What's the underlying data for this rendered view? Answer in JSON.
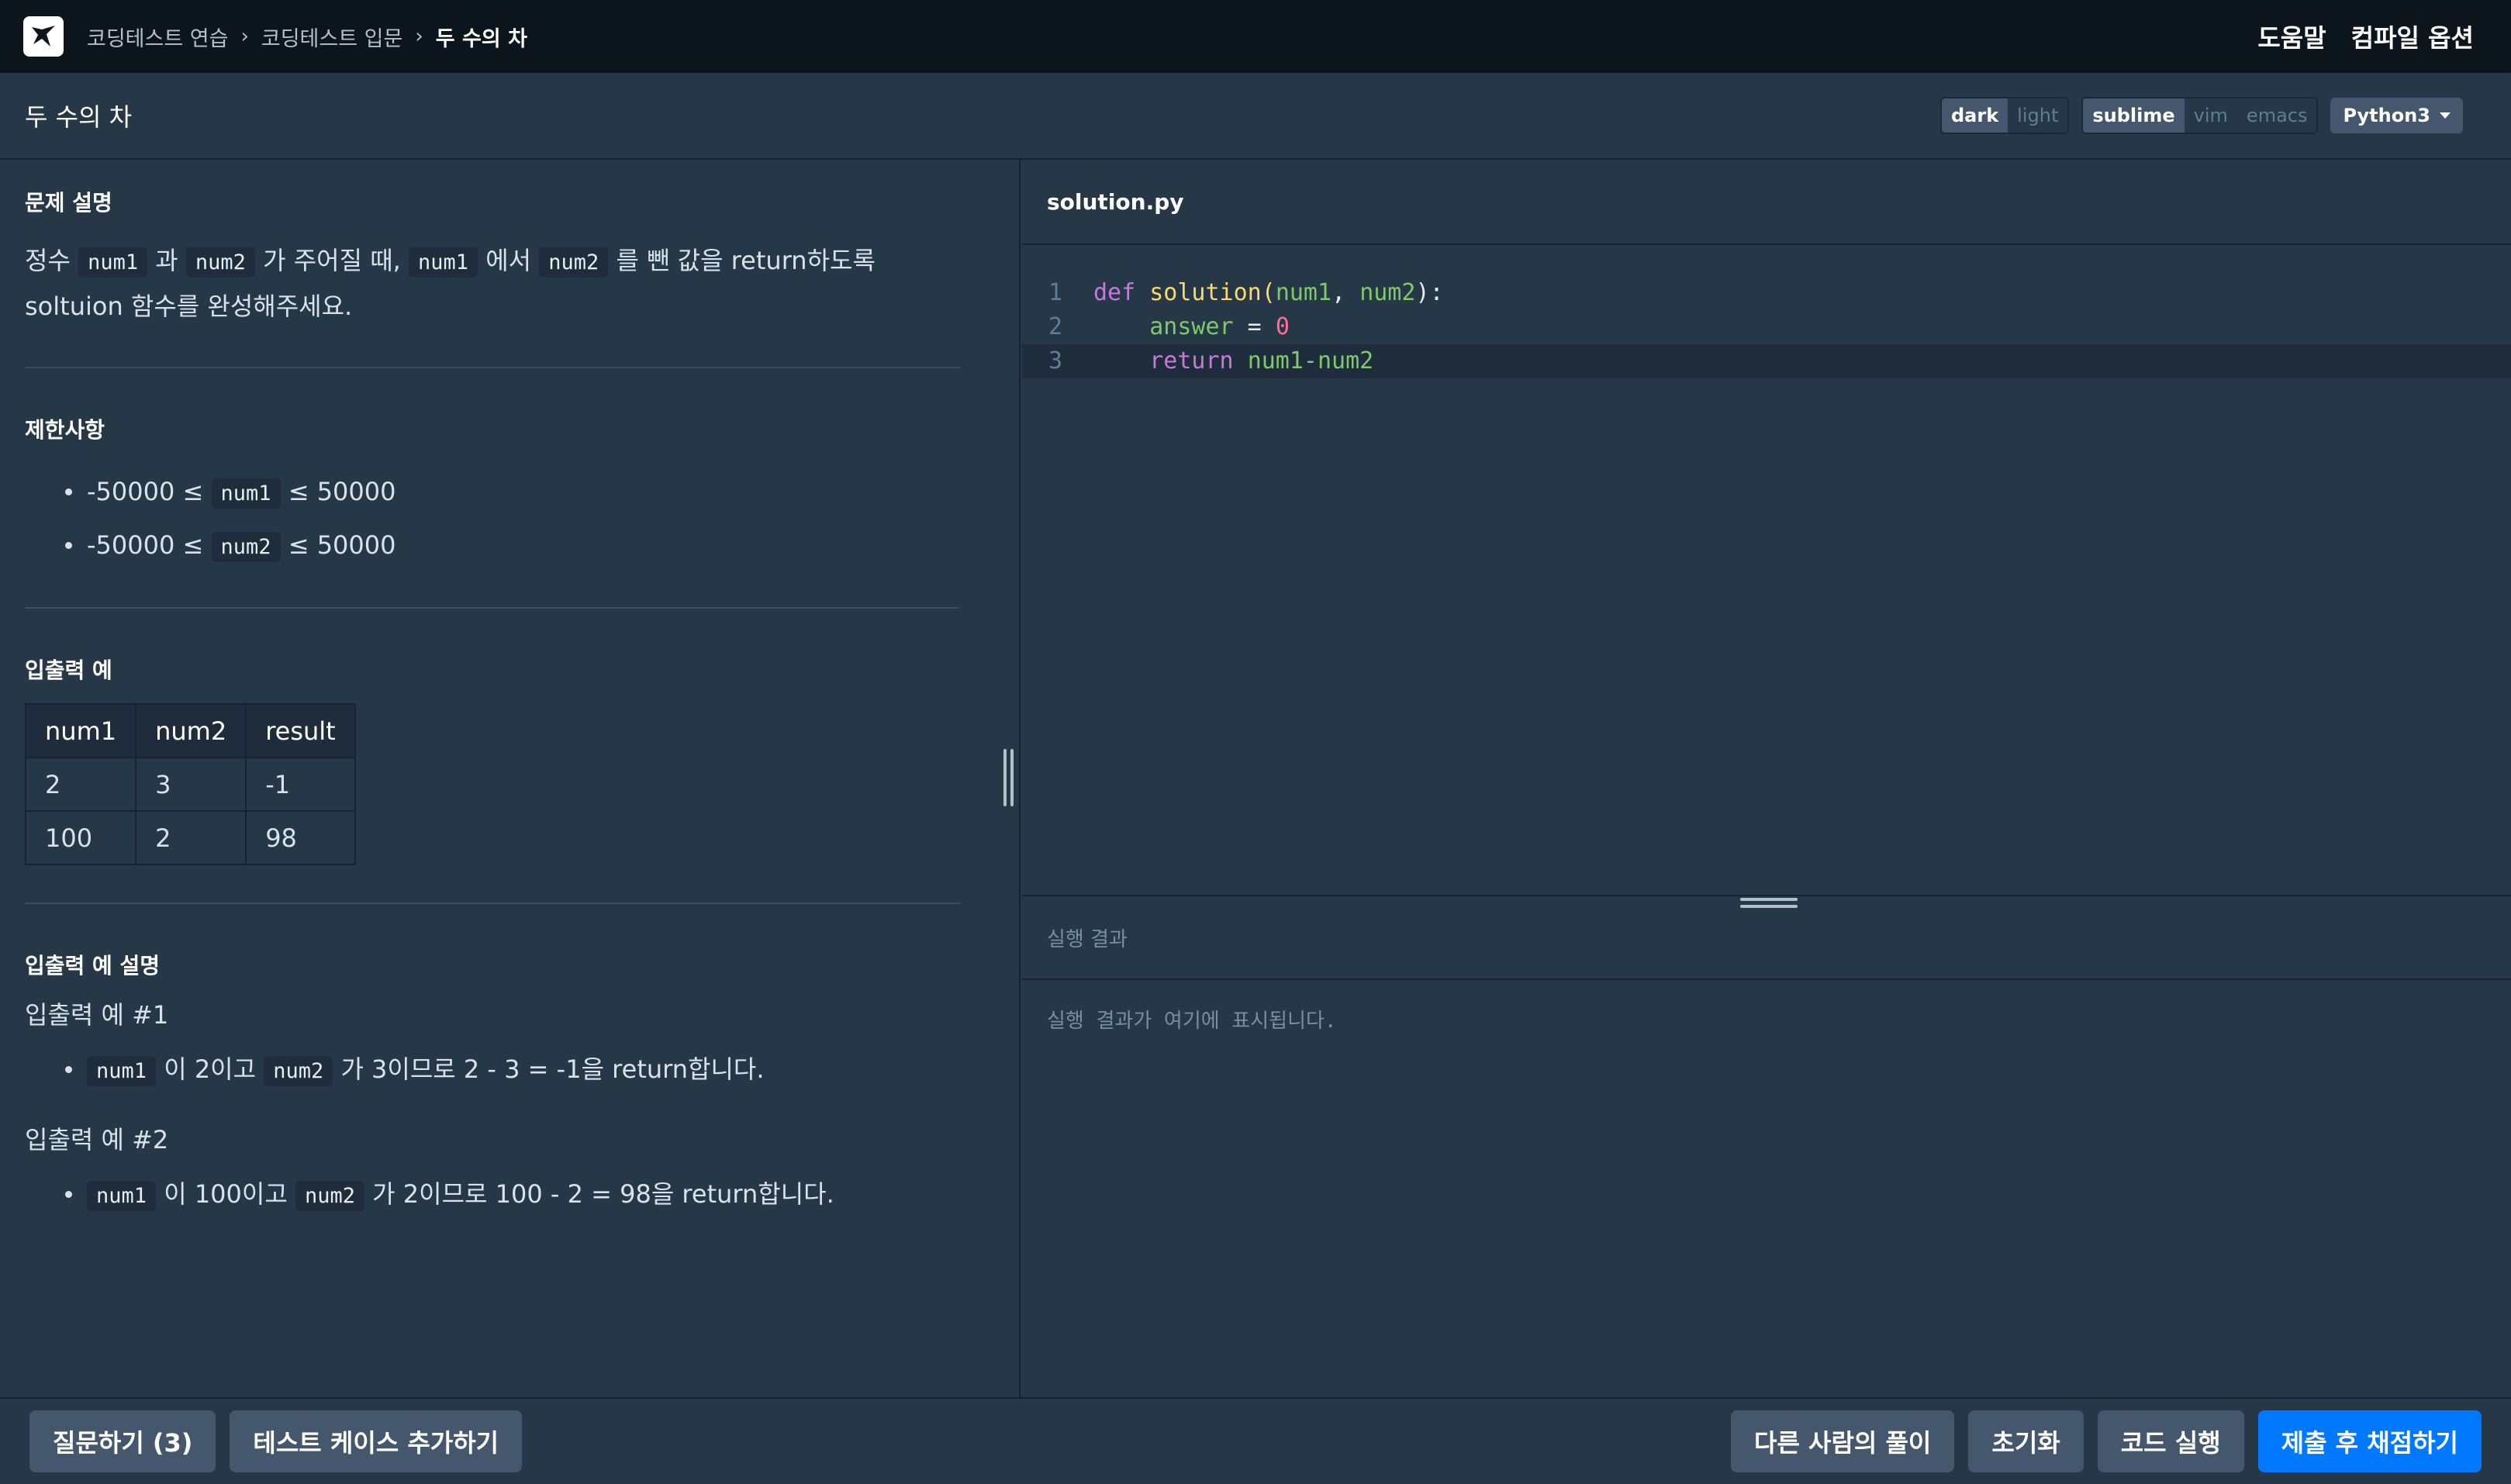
{
  "header": {
    "breadcrumbs": [
      "코딩테스트 연습",
      "코딩테스트 입문",
      "두 수의 차"
    ],
    "nav": [
      "도움말",
      "컴파일 옵션"
    ]
  },
  "title": "두 수의 차",
  "settings": {
    "theme": [
      "dark",
      "light"
    ],
    "keymap": [
      "sublime",
      "vim",
      "emacs"
    ],
    "language": "Python3"
  },
  "problem": {
    "desc_title": "문제 설명",
    "desc": {
      "t1": "정수 ",
      "c1": "num1",
      "t2": " 과 ",
      "c2": "num2",
      "t3": " 가 주어질 때, ",
      "c3": "num1",
      "t4": " 에서 ",
      "c4": "num2",
      "t5": " 를 뺀 값을 return하도록 soltuion 함수를 완성해주세요."
    },
    "constraints_title": "제한사항",
    "constraints": [
      {
        "pre": "-50000 ≤ ",
        "code": "num1",
        "post": " ≤ 50000"
      },
      {
        "pre": "-50000 ≤ ",
        "code": "num2",
        "post": " ≤ 50000"
      }
    ],
    "examples_title": "입출력 예",
    "table": {
      "headers": [
        "num1",
        "num2",
        "result"
      ],
      "rows": [
        [
          "2",
          "3",
          "-1"
        ],
        [
          "100",
          "2",
          "98"
        ]
      ]
    },
    "explain_title": "입출력 예 설명",
    "explains": [
      {
        "label": "입출력 예 #1",
        "c1": "num1",
        "t1": " 이 2이고 ",
        "c2": "num2",
        "t2": " 가 3이므로 2 - 3 = -1을 return합니다."
      },
      {
        "label": "입출력 예 #2",
        "c1": "num1",
        "t1": " 이 100이고 ",
        "c2": "num2",
        "t2": " 가 2이므로 100 - 2 = 98을 return합니다."
      }
    ]
  },
  "editor": {
    "filename": "solution.py",
    "line_numbers": [
      "1",
      "2",
      "3"
    ],
    "l1": {
      "kw": "def",
      "fn": "solution",
      "p1": "(",
      "a1": "num1",
      "comma": ", ",
      "a2": "num2",
      "p2": "):"
    },
    "l2": {
      "var": "answer",
      "eq": " = ",
      "num": "0"
    },
    "l3": {
      "kw": "return",
      "expr": "num1-num2"
    }
  },
  "result": {
    "title": "실행 결과",
    "placeholder": "실행 결과가 여기에 표시됩니다."
  },
  "buttons": {
    "question": "질문하기 (3)",
    "add_test": "테스트 케이스 추가하기",
    "others": "다른 사람의 풀이",
    "reset": "초기화",
    "run": "코드 실행",
    "submit": "제출 후 채점하기"
  }
}
